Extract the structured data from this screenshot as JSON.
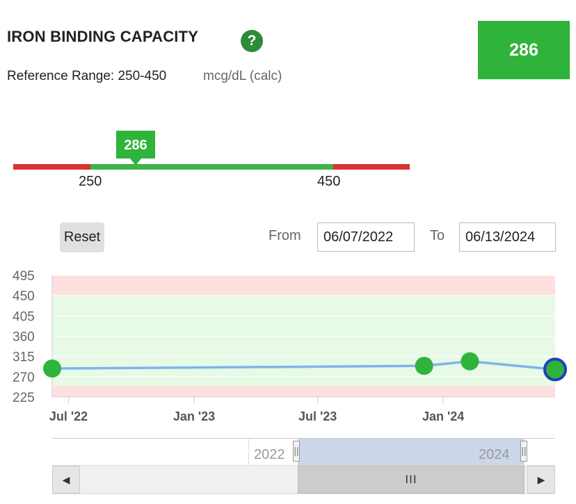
{
  "header": {
    "title": "IRON BINDING CAPACITY",
    "help_icon": "?",
    "reference_label": "Reference Range: 250-450",
    "unit": "mcg/dL (calc)",
    "result_value": "286"
  },
  "range_bar": {
    "low": 250,
    "high": 450,
    "low_label": "250",
    "high_label": "450",
    "marker_label": "286",
    "marker_value": 286,
    "colors": {
      "out_of_range": "#d83232",
      "in_range": "#3db449",
      "marker": "#30b33a"
    }
  },
  "controls": {
    "reset_label": "Reset",
    "from_label": "From",
    "from_value": "06/07/2022",
    "to_label": "To",
    "to_value": "06/13/2024"
  },
  "chart_data": {
    "type": "line",
    "y_ticks": [
      "495",
      "450",
      "405",
      "360",
      "315",
      "270",
      "225"
    ],
    "ylim": [
      225,
      495
    ],
    "x_ticks": [
      "Jul '22",
      "Jan '23",
      "Jul '23",
      "Jan '24"
    ],
    "x_tick_dates": [
      "2022-07-01",
      "2023-01-01",
      "2023-07-01",
      "2024-01-01"
    ],
    "xlim": [
      "2022-06-07",
      "2024-06-13"
    ],
    "normal_range": [
      250,
      450
    ],
    "band_colors": {
      "normal": "#e6fae6",
      "abnormal": "#ffe0e0"
    },
    "line_color": "#7cb5ec",
    "point_color": "#30b33a",
    "series": [
      {
        "x": [
          "2022-06-07",
          "2023-12-04",
          "2024-02-09",
          "2024-06-13"
        ],
        "values": [
          288,
          294,
          304,
          286
        ]
      }
    ]
  },
  "navigator": {
    "label_left": "2022",
    "label_right": "2024",
    "handle_glyph": "||",
    "thumb_glyph": "III",
    "left_arrow": "◀",
    "right_arrow": "▶"
  }
}
